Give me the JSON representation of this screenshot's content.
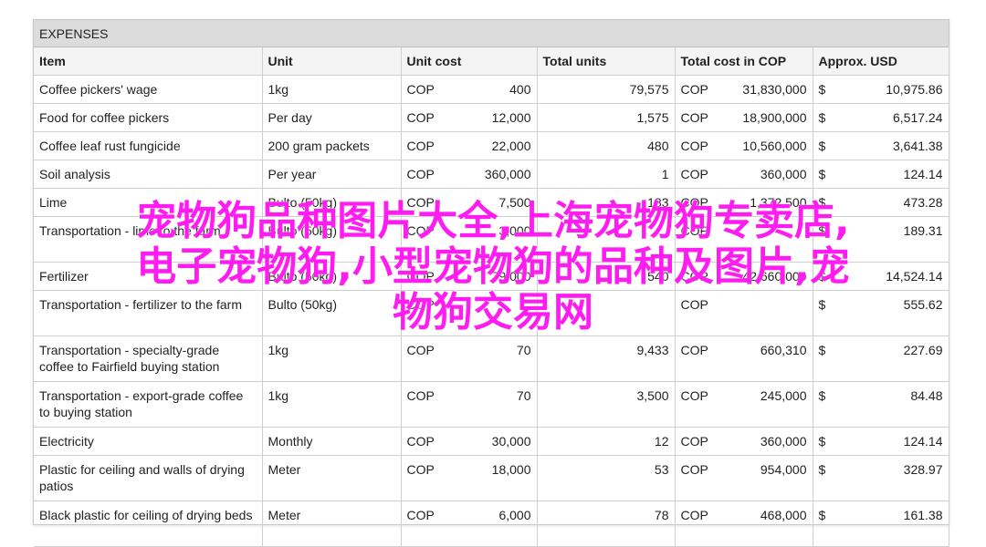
{
  "sheet": {
    "band_title": "EXPENSES",
    "headers": [
      "Item",
      "Unit",
      "Unit cost",
      "Total units",
      "Total cost in COP",
      "Approx. USD"
    ],
    "rows": [
      {
        "item": "Coffee pickers' wage",
        "unit": "1kg",
        "uc_cur": "COP",
        "uc": "400",
        "tu": "79,575",
        "tc_cur": "COP",
        "tc": "31,830,000",
        "usd_cur": "$",
        "usd": "10,975.86"
      },
      {
        "item": "Food for coffee pickers",
        "unit": "Per day",
        "uc_cur": "COP",
        "uc": "12,000",
        "tu": "1,575",
        "tc_cur": "COP",
        "tc": "18,900,000",
        "usd_cur": "$",
        "usd": "6,517.24"
      },
      {
        "item": "Coffee leaf rust fungicide",
        "unit": "200 gram packets",
        "uc_cur": "COP",
        "uc": "22,000",
        "tu": "480",
        "tc_cur": "COP",
        "tc": "10,560,000",
        "usd_cur": "$",
        "usd": "3,641.38"
      },
      {
        "item": "Soil analysis",
        "unit": "Per year",
        "uc_cur": "COP",
        "uc": "360,000",
        "tu": "1",
        "tc_cur": "COP",
        "tc": "360,000",
        "usd_cur": "$",
        "usd": "124.14"
      },
      {
        "item": "Lime",
        "unit": "Bulto (50kg)",
        "uc_cur": "COP",
        "uc": "7,500",
        "tu": "183",
        "tc_cur": "COP",
        "tc": "1,372,500",
        "usd_cur": "$",
        "usd": "473.28"
      },
      {
        "item": "Transportation - lime to the farm",
        "unit": "Bulto (50kg)",
        "uc_cur": "COP",
        "uc": "3,000",
        "tu": "",
        "tc_cur": "COP",
        "tc": "",
        "usd_cur": "$",
        "usd": "189.31"
      },
      {
        "item": "Fertilizer",
        "unit": "Bulto (50kg)",
        "uc_cur": "COP",
        "uc": "79,000",
        "tu": "540",
        "tc_cur": "COP",
        "tc": "42,660,000",
        "usd_cur": "$",
        "usd": "14,524.14"
      },
      {
        "item": "Transportation - fertilizer to the farm",
        "unit": "Bulto (50kg)",
        "uc_cur": "COP",
        "uc": "",
        "tu": "",
        "tc_cur": "COP",
        "tc": "",
        "usd_cur": "$",
        "usd": "555.62"
      },
      {
        "item": "Transportation - specialty-grade coffee to Fairfield buying station",
        "unit": "1kg",
        "uc_cur": "COP",
        "uc": "70",
        "tu": "9,433",
        "tc_cur": "COP",
        "tc": "660,310",
        "usd_cur": "$",
        "usd": "227.69"
      },
      {
        "item": "Transportation - export-grade coffee to buying station",
        "unit": "1kg",
        "uc_cur": "COP",
        "uc": "70",
        "tu": "3,500",
        "tc_cur": "COP",
        "tc": "245,000",
        "usd_cur": "$",
        "usd": "84.48"
      },
      {
        "item": "Electricity",
        "unit": "Monthly",
        "uc_cur": "COP",
        "uc": "30,000",
        "tu": "12",
        "tc_cur": "COP",
        "tc": "360,000",
        "usd_cur": "$",
        "usd": "124.14"
      },
      {
        "item": "Plastic for ceiling and walls of drying patios",
        "unit": "Meter",
        "uc_cur": "COP",
        "uc": "18,000",
        "tu": "53",
        "tc_cur": "COP",
        "tc": "954,000",
        "usd_cur": "$",
        "usd": "328.97"
      },
      {
        "item": "Black plastic for ceiling of drying beds",
        "unit": "Meter",
        "uc_cur": "COP",
        "uc": "6,000",
        "tu": "78",
        "tc_cur": "COP",
        "tc": "468,000",
        "usd_cur": "$",
        "usd": "161.38"
      }
    ]
  },
  "watermark": {
    "line1": "宠物狗品种图片大全,上海宠物狗专卖店,",
    "line2": "电子宠物狗,小型宠物狗的品种及图片,宠",
    "line3": "物狗交易网",
    "color": "#ff1cf0"
  }
}
